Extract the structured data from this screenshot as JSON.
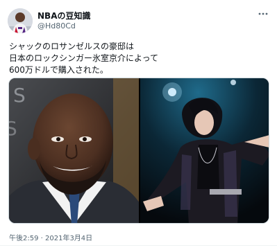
{
  "tweet": {
    "display_name": "NBAの豆知識",
    "handle": "@Hd80Cd",
    "text_lines": [
      "シャックのロサンゼルスの豪邸は",
      "日本のロックシンガー氷室京介によって",
      "600万ドルで購入された。"
    ],
    "timestamp": "午後2:59 · 2021年3月4日",
    "more_icon": "more-horizontal-icon"
  },
  "media": [
    {
      "alt_name": "photo-shaquille-oneal"
    },
    {
      "alt_name": "photo-kyosuke-himuro-concert"
    }
  ],
  "colors": {
    "text": "#0f1419",
    "secondary": "#536471",
    "border": "#cfd9de"
  }
}
